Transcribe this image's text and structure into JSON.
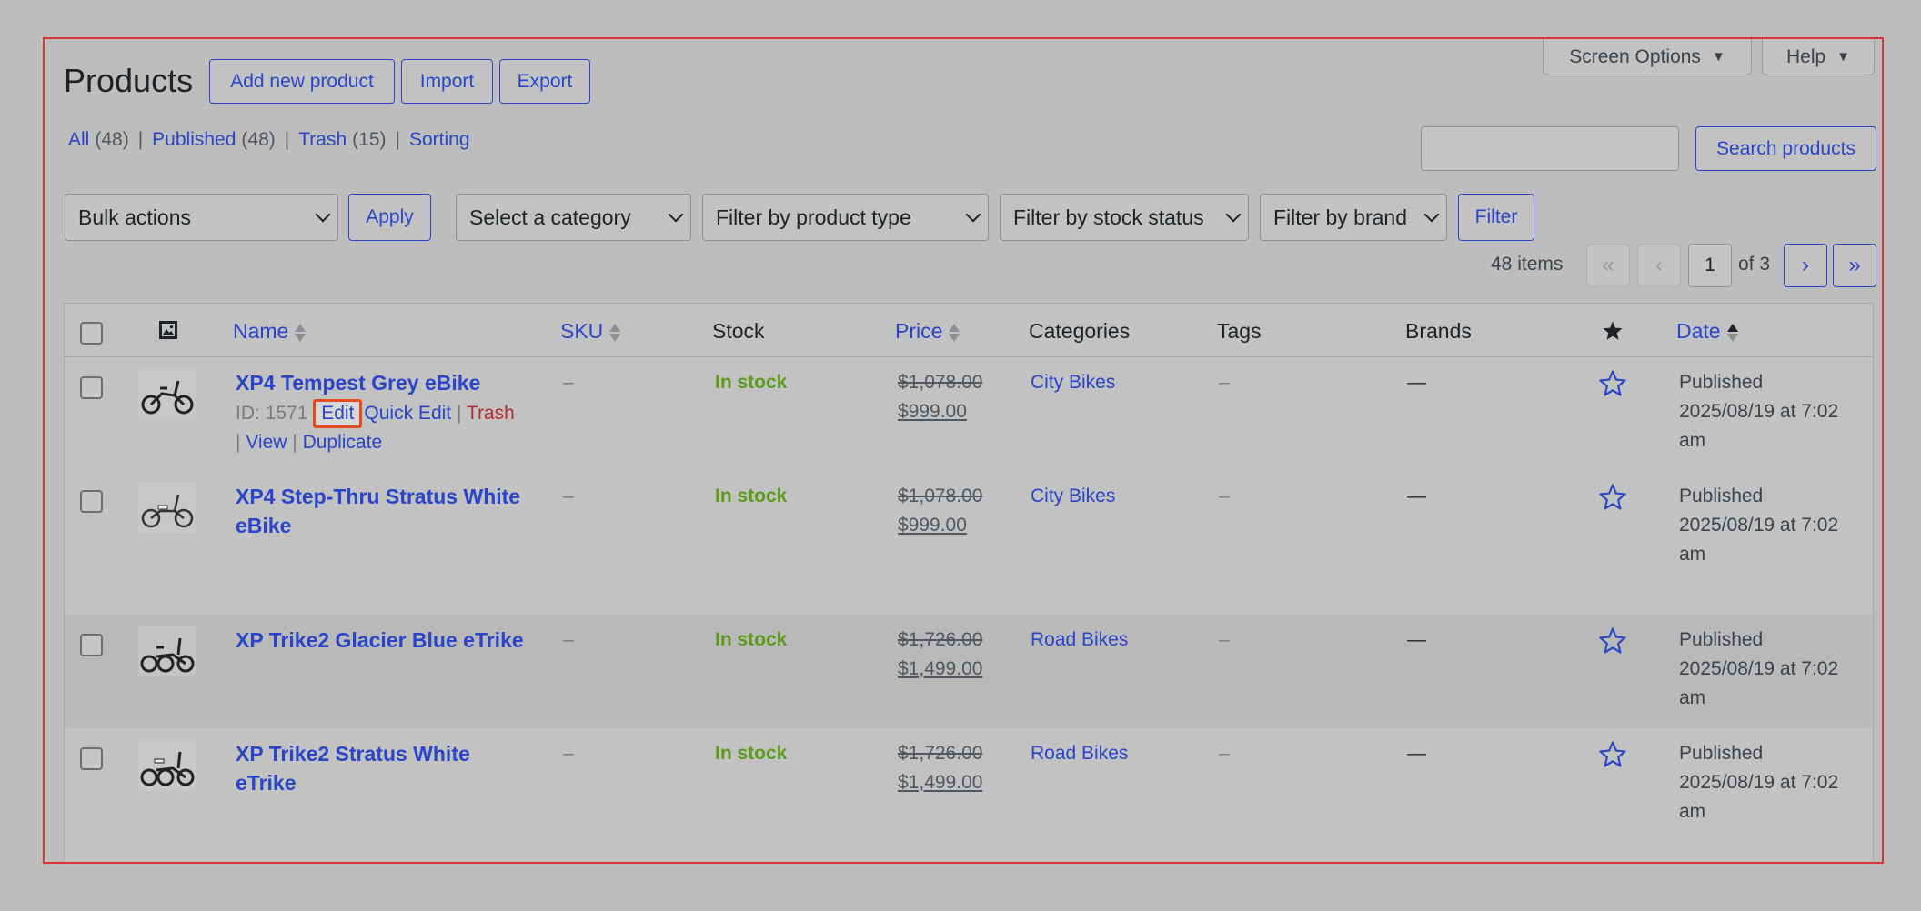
{
  "header": {
    "title": "Products",
    "add_new": "Add new product",
    "import": "Import",
    "export": "Export",
    "screen_options": "Screen Options",
    "help": "Help"
  },
  "views": [
    {
      "label": "All",
      "count": "(48)"
    },
    {
      "label": "Published",
      "count": "(48)"
    },
    {
      "label": "Trash",
      "count": "(15)"
    },
    {
      "label": "Sorting",
      "count": ""
    }
  ],
  "search": {
    "value": "",
    "button": "Search products"
  },
  "filters": {
    "bulk_actions": "Bulk actions",
    "apply": "Apply",
    "category": "Select a category",
    "product_type": "Filter by product type",
    "stock_status": "Filter by stock status",
    "brand": "Filter by brand",
    "filter": "Filter"
  },
  "pagination": {
    "items": "48 items",
    "first": "«",
    "prev": "‹",
    "current": "1",
    "of": "of 3",
    "next": "›",
    "last": "»"
  },
  "columns": {
    "name": "Name",
    "sku": "SKU",
    "stock": "Stock",
    "price": "Price",
    "categories": "Categories",
    "tags": "Tags",
    "brands": "Brands",
    "date": "Date"
  },
  "rows": [
    {
      "name_line1": "XP4 Tempest Grey eBike",
      "name_line2": "",
      "id": "ID: 1571",
      "edit": "Edit",
      "quick_edit": "Quick Edit",
      "trash": "Trash",
      "view": "View",
      "duplicate": "Duplicate",
      "sku": "–",
      "stock": "In stock",
      "price_old": "$1,078.00",
      "price_new": "$999.00",
      "category": "City Bikes",
      "tags": "–",
      "brands": "—",
      "date_status": "Published",
      "date_line1": "2025/08/19 at 7:02",
      "date_line2": "am"
    },
    {
      "name_line1": "XP4 Step-Thru Stratus White",
      "name_line2": "eBike",
      "sku": "–",
      "stock": "In stock",
      "price_old": "$1,078.00",
      "price_new": "$999.00",
      "category": "City Bikes",
      "tags": "–",
      "brands": "—",
      "date_status": "Published",
      "date_line1": "2025/08/19 at 7:02",
      "date_line2": "am"
    },
    {
      "name_line1": "XP Trike2 Glacier Blue eTrike",
      "name_line2": "",
      "sku": "–",
      "stock": "In stock",
      "price_old": "$1,726.00",
      "price_new": "$1,499.00",
      "category": "Road Bikes",
      "tags": "–",
      "brands": "—",
      "date_status": "Published",
      "date_line1": "2025/08/19 at 7:02",
      "date_line2": "am"
    },
    {
      "name_line1": "XP Trike2 Stratus White",
      "name_line2": "eTrike",
      "sku": "–",
      "stock": "In stock",
      "price_old": "$1,726.00",
      "price_new": "$1,499.00",
      "category": "Road Bikes",
      "tags": "–",
      "brands": "—",
      "date_status": "Published",
      "date_line1": "2025/08/19 at 7:02",
      "date_line2": "am"
    }
  ],
  "icons": {
    "thumbnail_column": "image-icon",
    "featured_column": "star-filled-icon",
    "featured_cell": "star-outline-icon",
    "product_thumb": "ebike-thumbnail-icon"
  },
  "colors": {
    "link": "#2a45c7",
    "in_stock": "#5b9a1c",
    "trash": "#b32d2e",
    "highlight": "#e44c1e"
  }
}
